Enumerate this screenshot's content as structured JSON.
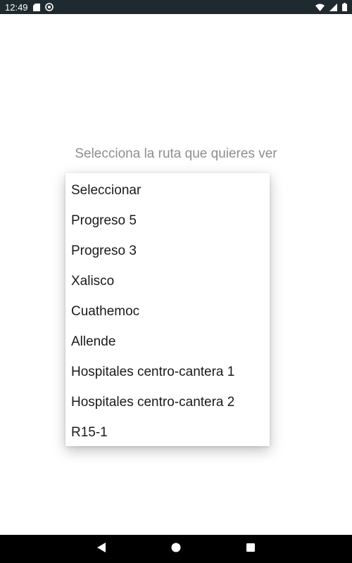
{
  "status_bar": {
    "time": "12:49",
    "left_icons": [
      "sd-card-icon",
      "sync-icon"
    ],
    "right_icons": [
      "wifi-icon",
      "signal-icon",
      "battery-icon"
    ]
  },
  "prompt": {
    "label": "Selecciona la ruta que quieres ver"
  },
  "route_dropdown": {
    "items": [
      "Seleccionar",
      "Progreso 5",
      "Progreso 3",
      "Xalisco",
      "Cuathemoc",
      "Allende",
      "Hospitales centro-cantera 1",
      "Hospitales centro-cantera 2",
      "R15-1"
    ]
  },
  "nav_bar": {
    "buttons": [
      "back-icon",
      "home-icon",
      "recents-icon"
    ]
  },
  "colors": {
    "status_bar_bg": "#1f2a30",
    "prompt_text": "#8e8e8e",
    "menu_text": "#1a1a1a",
    "nav_bar_bg": "#000000"
  }
}
